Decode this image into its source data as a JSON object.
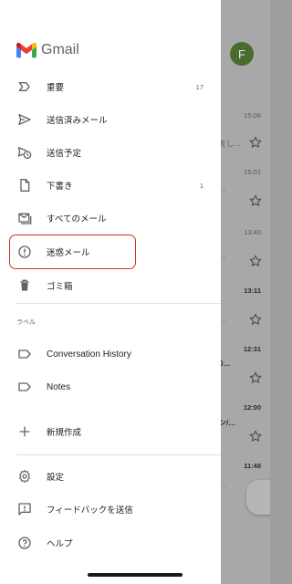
{
  "app": {
    "name": "Gmail",
    "colors": {
      "red": "#EA4335",
      "blue": "#4285F4",
      "green": "#34A853",
      "yellow": "#FBBC04",
      "highlight": "#D93025"
    }
  },
  "drawer": {
    "items": [
      {
        "label": "重要",
        "count": "17",
        "icon": "label-important-icon"
      },
      {
        "label": "送信済みメール",
        "count": "",
        "icon": "send-icon"
      },
      {
        "label": "送信予定",
        "count": "",
        "icon": "schedule-send-icon"
      },
      {
        "label": "下書き",
        "count": "1",
        "icon": "draft-icon"
      },
      {
        "label": "すべてのメール",
        "count": "",
        "icon": "all-mail-icon"
      },
      {
        "label": "迷惑メール",
        "count": "",
        "icon": "spam-icon"
      },
      {
        "label": "ゴミ箱",
        "count": "",
        "icon": "trash-icon"
      }
    ],
    "labels_header": "ラベル",
    "labels": [
      {
        "label": "Conversation History",
        "icon": "label-icon"
      },
      {
        "label": "Notes",
        "icon": "label-icon"
      }
    ],
    "create_new": {
      "label": "新規作成",
      "icon": "plus-icon"
    },
    "footer": [
      {
        "label": "設定",
        "icon": "settings-icon"
      },
      {
        "label": "フィードバックを送信",
        "icon": "feedback-icon"
      },
      {
        "label": "ヘルプ",
        "icon": "help-icon"
      }
    ]
  },
  "background_inbox": {
    "avatar_letter": "F",
    "rows": [
      {
        "time": "15:06",
        "time_bold": false,
        "fragment": "をし…",
        "fragment_bold": false
      },
      {
        "time": "15:01",
        "time_bold": false,
        "fragment": "…",
        "fragment_bold": false
      },
      {
        "time": "13:40",
        "time_bold": false,
        "fragment": "…",
        "fragment_bold": false
      },
      {
        "time": "13:11",
        "time_bold": true,
        "fragment": "…",
        "fragment_bold": false
      },
      {
        "time": "12:31",
        "time_bold": true,
        "fragment": "0…",
        "fragment_bold": true
      },
      {
        "time": "12:00",
        "time_bold": true,
        "fragment": "ン/…",
        "fragment_bold": true
      },
      {
        "time": "11:48",
        "time_bold": true,
        "fragment": "…",
        "fragment_bold": false
      }
    ]
  }
}
